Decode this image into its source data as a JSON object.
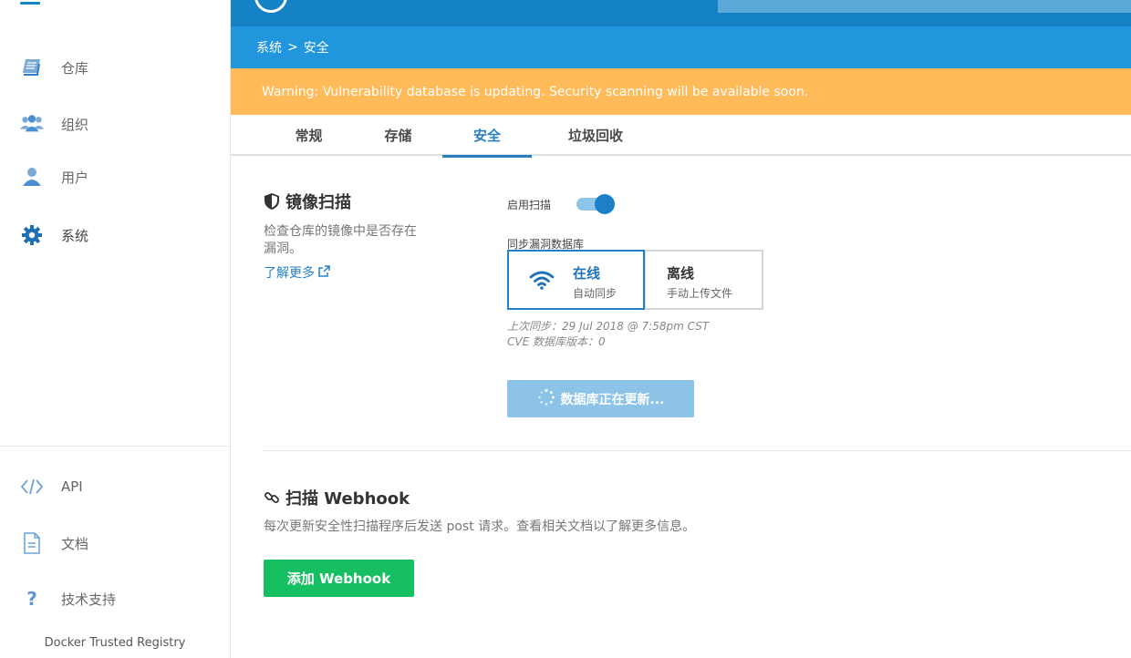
{
  "sidebar": {
    "items": [
      {
        "label": "仓库",
        "icon": "book-icon"
      },
      {
        "label": "组织",
        "icon": "users-icon"
      },
      {
        "label": "用户",
        "icon": "user-icon"
      },
      {
        "label": "系统",
        "icon": "gear-icon"
      }
    ],
    "bottom_items": [
      {
        "label": "API",
        "icon": "code-icon"
      },
      {
        "label": "文档",
        "icon": "document-icon"
      },
      {
        "label": "技术支持",
        "icon": "question-icon"
      }
    ],
    "footer": "Docker Trusted Registry"
  },
  "breadcrumb": {
    "parent": "系统",
    "separator": ">",
    "current": "安全"
  },
  "warning": "Warning: Vulnerability database is updating. Security scanning will be available soon.",
  "tabs": [
    {
      "label": "常规",
      "active": false
    },
    {
      "label": "存储",
      "active": false
    },
    {
      "label": "安全",
      "active": true
    },
    {
      "label": "垃圾回收",
      "active": false
    }
  ],
  "scanning": {
    "title": "镜像扫描",
    "description_line1": "检查仓库的镜像中是否存在",
    "description_line2": "漏洞。",
    "learn_more": "了解更多",
    "enable_label": "启用扫描",
    "enabled": true,
    "sync_label": "同步漏洞数据库",
    "online_title": "在线",
    "online_sub": "自动同步",
    "offline_title": "离线",
    "offline_sub": "手动上传文件",
    "last_sync": "上次同步：29 Jul 2018 @ 7:58pm CST",
    "cve_version": "CVE 数据库版本：0",
    "updating_button": "数据库正在更新..."
  },
  "webhook": {
    "title": "扫描 Webhook",
    "description": "每次更新安全性扫描程序后发送 post 请求。查看相关文档以了解更多信息。",
    "add_button": "添加 Webhook"
  },
  "colors": {
    "header": "#1482c5",
    "breadcrumb_bar": "#2196dc",
    "warning": "#ffba5a",
    "accent": "#2a7fbf",
    "add_button": "#17bf63"
  }
}
